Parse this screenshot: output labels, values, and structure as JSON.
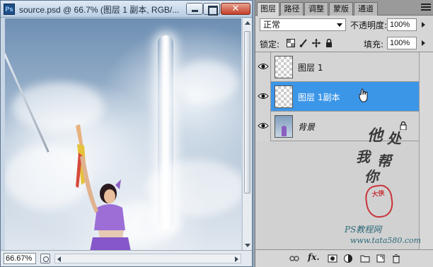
{
  "document": {
    "title": "source.psd @ 66.7% (图层 1 副本, RGB/...",
    "zoom": "66.67%",
    "close_symbol": "✕",
    "app_icon_text": "Ps"
  },
  "panel": {
    "tabs": [
      {
        "label": "图层",
        "active": true
      },
      {
        "label": "路径",
        "active": false
      },
      {
        "label": "调整",
        "active": false
      },
      {
        "label": "蒙版",
        "active": false
      },
      {
        "label": "通道",
        "active": false
      }
    ],
    "blend_mode": "正常",
    "opacity_label": "不透明度:",
    "opacity_value": "100%",
    "lock_label": "锁定:",
    "fill_label": "填充:",
    "fill_value": "100%",
    "layers": [
      {
        "name": "图层 1",
        "visible": true,
        "selected": false,
        "thumbnail": "transparent"
      },
      {
        "name": "图层 1副本",
        "visible": true,
        "selected": true,
        "thumbnail": "transparent"
      },
      {
        "name": "背景",
        "visible": true,
        "selected": false,
        "thumbnail": "photo",
        "locked": true
      }
    ],
    "bottom_icons": [
      "link-icon",
      "fx-icon",
      "mask-icon",
      "adjustment-icon",
      "folder-icon",
      "new-layer-icon",
      "trash-icon"
    ],
    "fx_label": "fx."
  },
  "watermark": {
    "chars": [
      "他",
      "处",
      "我",
      "帮",
      "你"
    ],
    "seal": "大侠",
    "caption": "PS教程网",
    "url": "www.tata580.com"
  },
  "colors": {
    "selected_row": "#3c96e8",
    "panel_bg": "#d6d6d6",
    "close_button": "#c4402b"
  }
}
